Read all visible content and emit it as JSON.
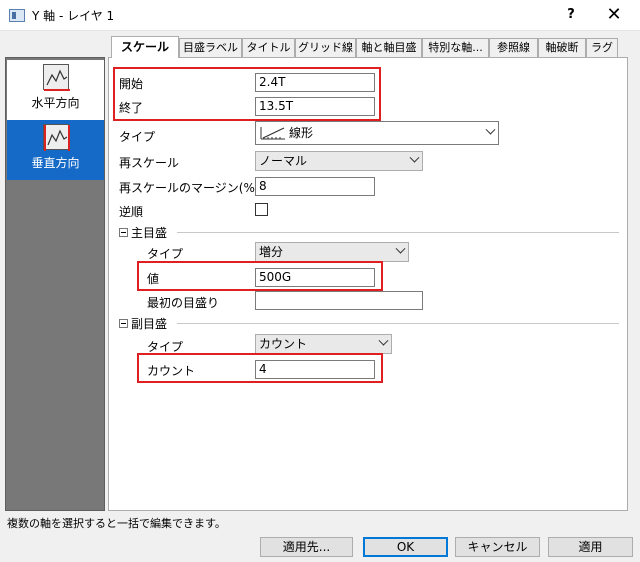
{
  "window": {
    "title": "Y 軸 - レイヤ 1",
    "help_label": "?",
    "close_label": "✕"
  },
  "sidebar": {
    "items": [
      {
        "label": "水平方向",
        "icon": "horizontal-axis-icon",
        "selected": false
      },
      {
        "label": "垂直方向",
        "icon": "vertical-axis-icon",
        "selected": true
      }
    ],
    "selected_color": "#1569c7"
  },
  "tabs": [
    "スケール",
    "目盛ラベル",
    "タイトル",
    "グリッド線",
    "軸と軸目盛",
    "特別な軸...",
    "参照線",
    "軸破断",
    "ラグ"
  ],
  "scale": {
    "start_label": "開始",
    "start_value": "2.4T",
    "end_label": "終了",
    "end_value": "13.5T",
    "type_label": "タイプ",
    "type_value": "線形",
    "rescale_label": "再スケール",
    "rescale_value": "ノーマル",
    "margin_label": "再スケールのマージン(%)",
    "margin_value": "8",
    "reverse_label": "逆順"
  },
  "major": {
    "section_label": "主目盛",
    "type_label": "タイプ",
    "type_value": "増分",
    "value_label": "値",
    "value_value": "500G",
    "first_label": "最初の目盛り",
    "first_value": ""
  },
  "minor": {
    "section_label": "副目盛",
    "type_label": "タイプ",
    "type_value": "カウント",
    "count_label": "カウント",
    "count_value": "4"
  },
  "status_text": "複数の軸を選択すると一括で編集できます。",
  "buttons": {
    "apply_to": "適用先...",
    "ok": "OK",
    "cancel": "キャンセル",
    "apply": "適用"
  },
  "highlight_color": "#e02020"
}
